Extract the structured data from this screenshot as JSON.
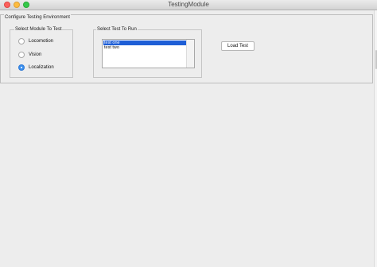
{
  "window": {
    "title": "TestingModule"
  },
  "config_group": {
    "legend": "Configure Testing Environment"
  },
  "module_group": {
    "legend": "Select Module To Test",
    "options": [
      {
        "label": "Locomotion",
        "selected": false
      },
      {
        "label": "Vision",
        "selected": false
      },
      {
        "label": "Localization",
        "selected": true
      }
    ]
  },
  "test_group": {
    "legend": "Select Test To Run",
    "items": [
      {
        "label": "test one",
        "selected": true
      },
      {
        "label": "test two",
        "selected": false
      }
    ]
  },
  "actions": {
    "load_label": "Load Test"
  },
  "colors": {
    "accent": "#1e5ed6",
    "radio_selected": "#3a8fef",
    "close": "#fc605c",
    "minimize": "#fdbc40",
    "maximize": "#34c84a"
  }
}
